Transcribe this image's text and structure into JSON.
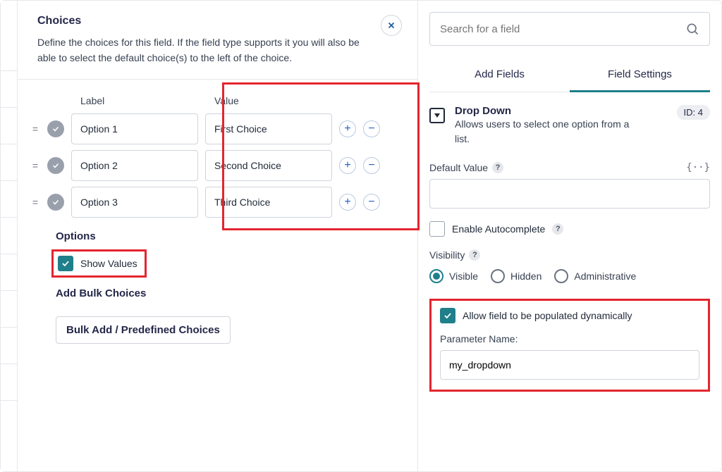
{
  "left": {
    "title": "Choices",
    "subtitle": "Define the choices for this field. If the field type supports it you will also be able to select the default choice(s) to the left of the choice.",
    "columns": {
      "label": "Label",
      "value": "Value"
    },
    "rows": [
      {
        "label": "Option 1",
        "value": "First Choice"
      },
      {
        "label": "Option 2",
        "value": "Second Choice"
      },
      {
        "label": "Option 3",
        "value": "Third Choice"
      }
    ],
    "options_heading": "Options",
    "show_values_label": "Show Values",
    "add_bulk_heading": "Add Bulk Choices",
    "bulk_button": "Bulk Add / Predefined Choices"
  },
  "right": {
    "search_placeholder": "Search for a field",
    "tabs": {
      "add": "Add Fields",
      "settings": "Field Settings"
    },
    "field": {
      "title": "Drop Down",
      "desc": "Allows users to select one option from a list.",
      "id_badge": "ID: 4"
    },
    "default_value_label": "Default Value",
    "default_value": "",
    "enable_ac_label": "Enable Autocomplete",
    "visibility_label": "Visibility",
    "visibility_options": {
      "visible": "Visible",
      "hidden": "Hidden",
      "admin": "Administrative"
    },
    "allow_dynamic_label": "Allow field to be populated dynamically",
    "param_name_label": "Parameter Name:",
    "param_name_value": "my_dropdown"
  }
}
